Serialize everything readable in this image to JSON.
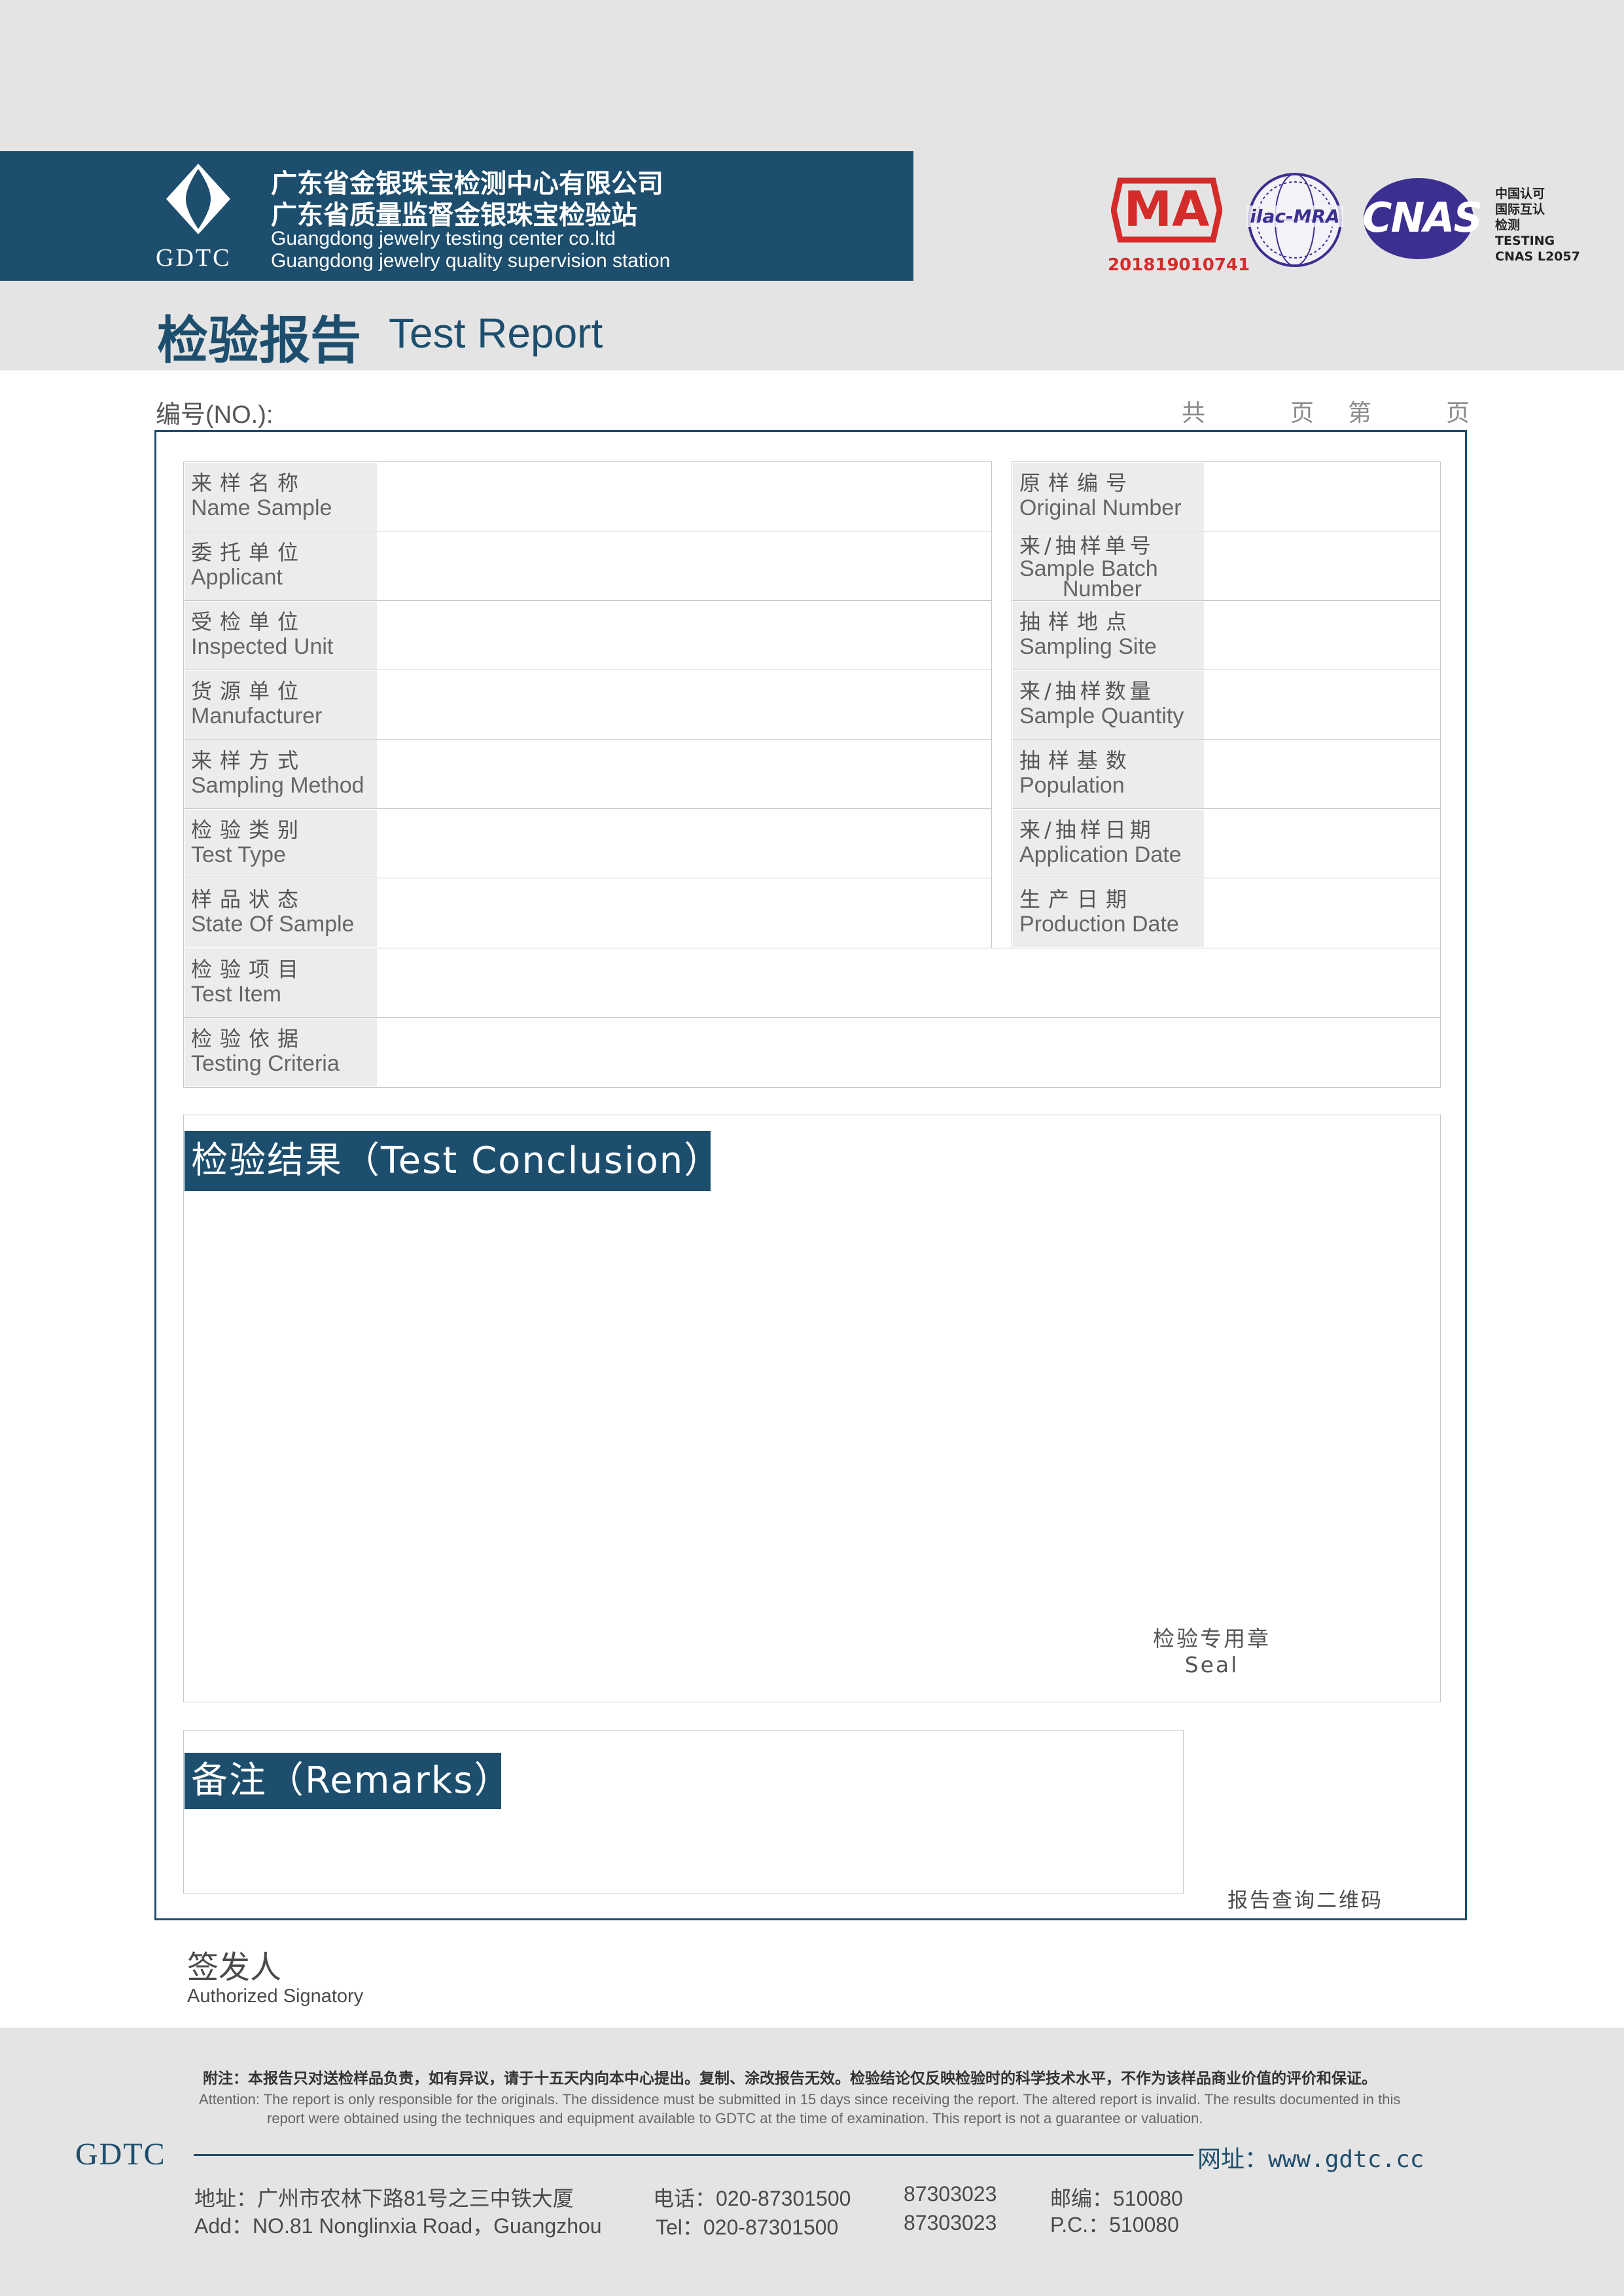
{
  "header": {
    "logo_text": "GDTC",
    "company_cn_1": "广东省金银珠宝检测中心有限公司",
    "company_cn_2": "广东省质量监督金银珠宝检验站",
    "company_en_1": "Guangdong jewelry testing center co.ltd",
    "company_en_2": "Guangdong jewelry quality supervision station",
    "ma_text": "MA",
    "ma_number": "201819010741",
    "ilac_text": "ilac-MRA",
    "cnas_text": "CNAS",
    "cnas_note": [
      "中国认可",
      "国际互认",
      "检测",
      "TESTING",
      "CNAS L2057"
    ],
    "colors": {
      "brand": "#1d4e6e",
      "ma_red": "#d42b2b",
      "cnas_purple": "#3b2f8f"
    }
  },
  "title": {
    "cn": "检验报告",
    "en": "Test Report"
  },
  "meta": {
    "no_label": "编号(NO.):",
    "total": "共",
    "page1": "页",
    "nth": "第",
    "page2": "页"
  },
  "fields_left": [
    {
      "cn": "来样名称",
      "en": "Name Sample"
    },
    {
      "cn": "委托单位",
      "en": "Applicant"
    },
    {
      "cn": "受检单位",
      "en": "Inspected Unit"
    },
    {
      "cn": "货源单位",
      "en": "Manufacturer"
    },
    {
      "cn": "来样方式",
      "en": "Sampling Method"
    },
    {
      "cn": "检验类别",
      "en": "Test Type"
    },
    {
      "cn": "样品状态",
      "en": "State Of Sample"
    }
  ],
  "fields_right": [
    {
      "cn": "原样编号",
      "en": "Original Number"
    },
    {
      "cn": "来/抽样单号",
      "en": "Sample Batch",
      "en2": "Number"
    },
    {
      "cn": "抽样地点",
      "en": "Sampling Site"
    },
    {
      "cn": "来/抽样数量",
      "en": "Sample Quantity"
    },
    {
      "cn": "抽样基数",
      "en": "Population"
    },
    {
      "cn": "来/抽样日期",
      "en": "Application Date"
    },
    {
      "cn": "生产日期",
      "en": "Production Date"
    }
  ],
  "fields_full": [
    {
      "cn": "检验项目",
      "en": "Test Item"
    },
    {
      "cn": "检验依据",
      "en": "Testing Criteria"
    }
  ],
  "conclusion": {
    "heading": "检验结果（Test Conclusion）",
    "seal_cn": "检验专用章",
    "seal_en": "Seal"
  },
  "remarks": {
    "heading": "备注（Remarks）",
    "qr_label": "报告查询二维码"
  },
  "signatory": {
    "cn": "签发人",
    "en": "Authorized Signatory"
  },
  "footer": {
    "note_cn": "附注：本报告只对送检样品负责，如有异议，请于十五天内向本中心提出。复制、涂改报告无效。检验结论仅反映检验时的科学技术水平，不作为该样品商业价值的评价和保证。",
    "note_en_1": "Attention: The report is only responsible for the originals. The dissidence must be submitted in 15 days since receiving the report. The altered report is invalid. The results documented in this",
    "note_en_2": "report were obtained using the techniques and equipment available to GDTC at the time of examination. This report is not a guarantee or valuation.",
    "logo": "GDTC",
    "website": "网址：www.gdtc.cc",
    "address_cn": "地址：广州市农林下路81号之三中铁大厦",
    "address_en": "Add：NO.81 Nonglinxia Road，Guangzhou",
    "tel_cn": "电话：020-87301500",
    "tel_en": "Tel：020-87301500",
    "tel2_cn": "87303023",
    "tel2_en": "87303023",
    "post_cn": "邮编：510080",
    "post_en": "P.C.：510080"
  }
}
